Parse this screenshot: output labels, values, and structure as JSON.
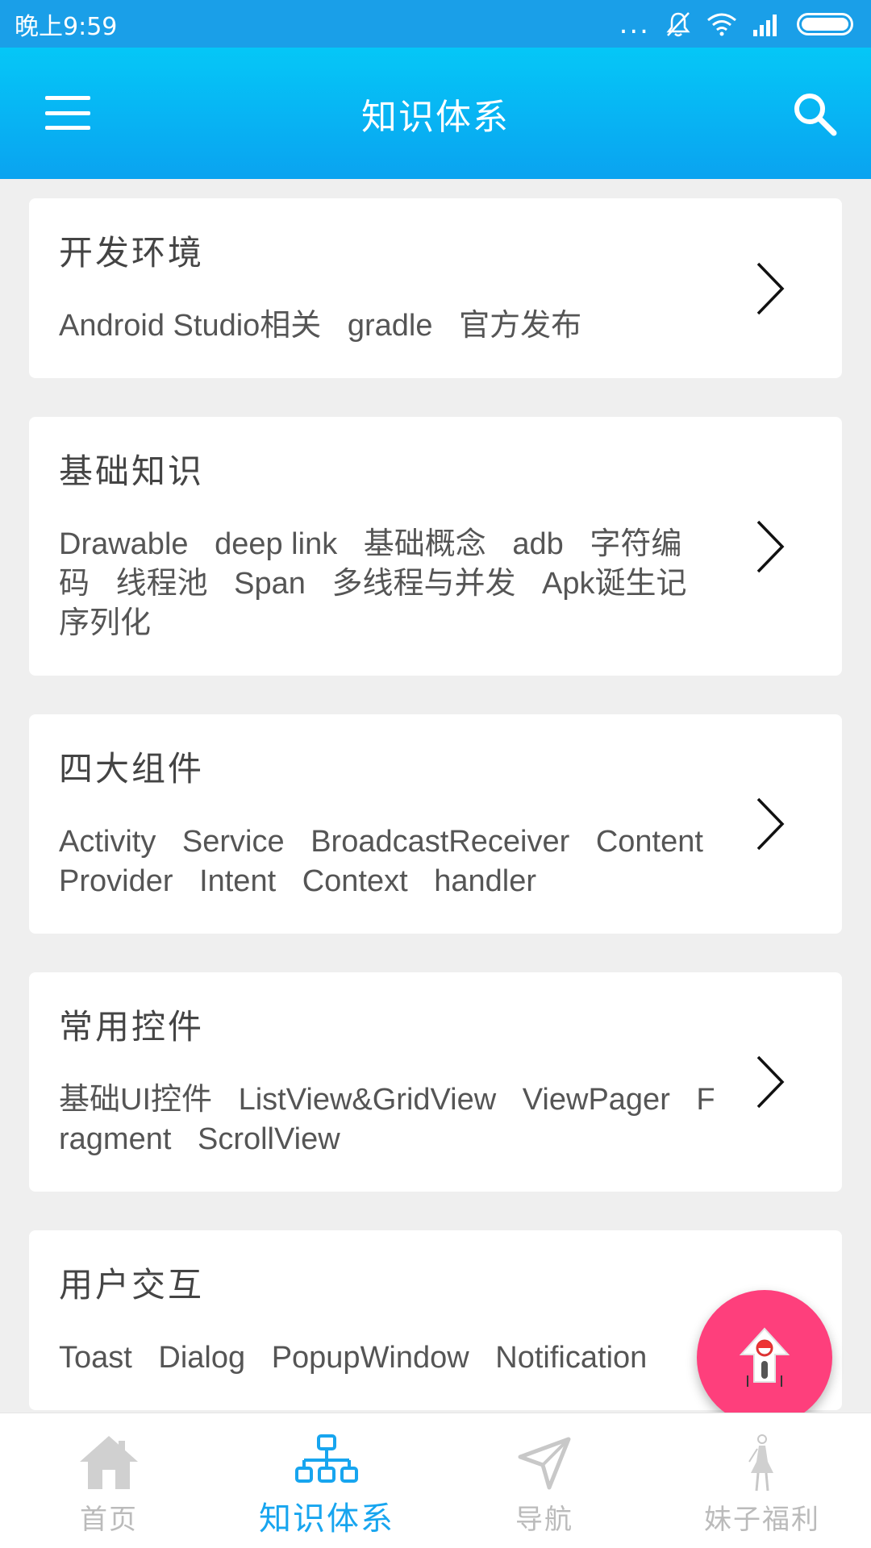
{
  "status_bar": {
    "time": "晚上9:59",
    "dots": "..."
  },
  "toolbar": {
    "title": "知识体系"
  },
  "categories": [
    {
      "title": "开发环境",
      "tags": [
        "Android Studio相关",
        "gradle",
        "官方发布"
      ]
    },
    {
      "title": "基础知识",
      "tags": [
        "Drawable",
        "deep link",
        "基础概念",
        "adb",
        "字符编码",
        "线程池",
        "Span",
        "多线程与并发",
        "Apk诞生记",
        "序列化"
      ]
    },
    {
      "title": "四大组件",
      "tags": [
        "Activity",
        "Service",
        "BroadcastReceiver",
        "ContentProvider",
        "Intent",
        "Context",
        "handler"
      ]
    },
    {
      "title": "常用控件",
      "tags": [
        "基础UI控件",
        "ListView&GridView",
        "ViewPager",
        "Fragment",
        "ScrollView"
      ]
    },
    {
      "title": "用户交互",
      "tags": [
        "Toast",
        "Dialog",
        "PopupWindow",
        "Notification"
      ]
    }
  ],
  "bottom_nav": [
    {
      "label": "首页",
      "icon": "home-icon",
      "active": false
    },
    {
      "label": "知识体系",
      "icon": "hierarchy-icon",
      "active": true
    },
    {
      "label": "导航",
      "icon": "navigation-icon",
      "active": false
    },
    {
      "label": "妹子福利",
      "icon": "girl-icon",
      "active": false
    }
  ],
  "colors": {
    "accent": "#17a5ef",
    "toolbar_top": "#05c7f7",
    "toolbar_bottom": "#0aa3f0",
    "fab": "#fe3f7c",
    "inactive": "#bbbbbb"
  }
}
